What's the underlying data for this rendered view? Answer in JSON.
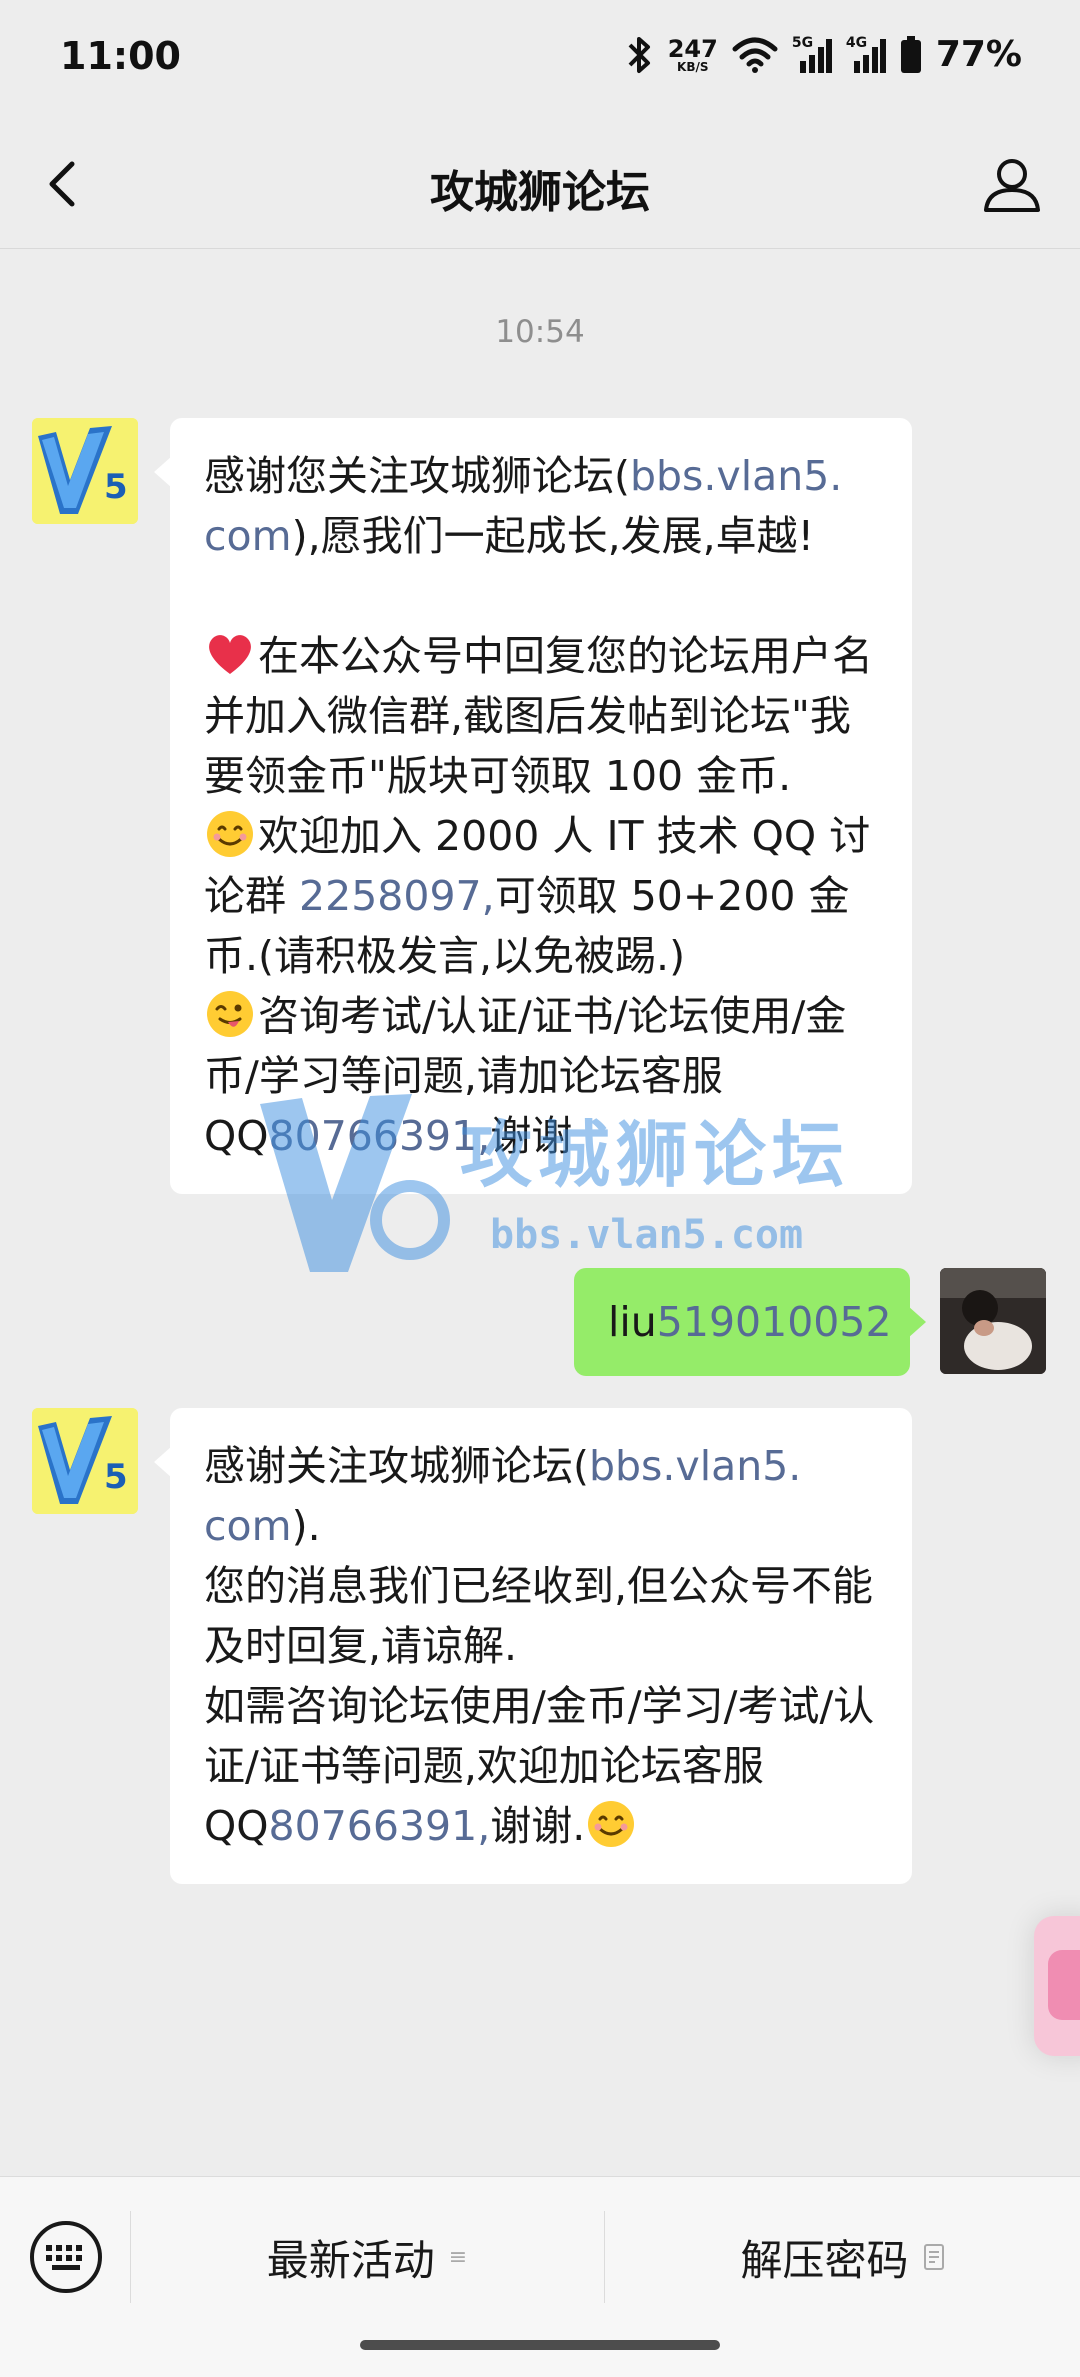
{
  "status_bar": {
    "time": "11:00",
    "net_speed_value": "247",
    "net_speed_unit": "KB/S",
    "signal_1_label": "5G",
    "signal_2_label": "4G",
    "battery": "77%",
    "icons": [
      "bluetooth-icon",
      "wifi-icon",
      "signal-5g-icon",
      "signal-4g-icon",
      "battery-icon"
    ]
  },
  "header": {
    "title": "攻城狮论坛",
    "back_icon": "chevron-left-icon",
    "profile_icon": "user-icon"
  },
  "chat": {
    "timestamp": "10:54",
    "messages": [
      {
        "direction": "incoming",
        "sender_avatar": "V5",
        "parts": {
          "l1a": "感谢您关注攻城狮论坛(",
          "l1link": "bbs.vlan5.",
          "l2link": "com",
          "l2b": "),愿我们一起成长,发展,卓越!",
          "p2": "在本公众号中回复您的论坛用户名并加入微信群,截图后发帖到论坛\"我要领金币\"版块可领取 100 金币.",
          "p3a": "欢迎加入 2000 人 IT 技术 QQ 讨论群 ",
          "p3link": "2258097,",
          "p3b": "可领取 50+200 金币.(请积极发言,以免被踢.)",
          "p4a": "咨询考试/认证/证书/论坛使用/金币/学习等问题,请加论坛客服 QQ",
          "p4link": "80766391,",
          "p4b": "谢谢"
        }
      },
      {
        "direction": "outgoing",
        "text_a": "liu",
        "text_link": "519010052"
      },
      {
        "direction": "incoming",
        "sender_avatar": "V5",
        "parts": {
          "l1a": "感谢关注攻城狮论坛(",
          "l1link": "bbs.vlan5.",
          "l2link": "com",
          "l2b": ").",
          "p2": "您的消息我们已经收到,但公众号不能及时回复,请谅解.",
          "p3a": "如需咨询论坛使用/金币/学习/考试/认证/证书等问题,欢迎加论坛客服 QQ",
          "p3link": "80766391,",
          "p3b": "谢谢."
        }
      }
    ]
  },
  "watermark": {
    "logo_text": "V5",
    "name": "攻城狮论坛",
    "url": "bbs.vlan5.com"
  },
  "bottom_menu": {
    "keyboard_icon": "keyboard-icon",
    "items": [
      {
        "label": "最新活动",
        "icon": "menu-lines-icon"
      },
      {
        "label": "解压密码",
        "icon": "document-icon"
      }
    ]
  },
  "colors": {
    "link": "#576b95",
    "outgoing_bubble": "#95ec69",
    "background": "#ededed"
  }
}
